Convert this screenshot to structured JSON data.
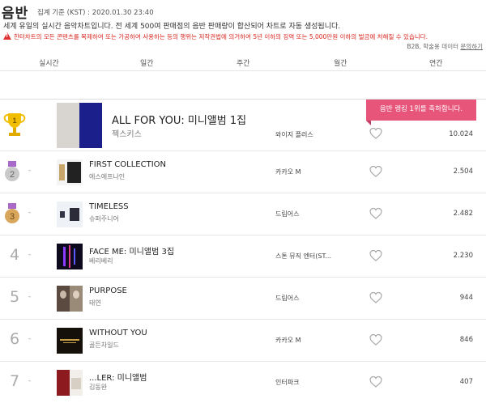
{
  "header": {
    "title": "음반",
    "basis": "집계 기준 (KST) : 2020.01.30 23:40"
  },
  "description": "세계 유일의 실시간 음악차트입니다. 전 세계 500여 판매점의 음반 판매량이 합산되어 차트로 자동 생성됩니다.",
  "warning": "한터차트의 모든 콘텐츠를 복제하여 또는 가공하여 사용하는 등의 행위는 저작권법에 의거하여 5년 이하의 징역 또는 5,000만원 이하의 벌금에 처해질 수 있습니다.",
  "b2b": {
    "text": "B2B, 학술용 데이터",
    "link": "문의하기"
  },
  "tabs": [
    "실시간",
    "일간",
    "주간",
    "월간",
    "연간"
  ],
  "ribbon": "음반 랭킹 1위를 축하합니다.",
  "rows": [
    {
      "rank": "1",
      "change": "",
      "title": "ALL FOR YOU: 미니앨범 1집",
      "artist": "젝스키스",
      "label": "와이지 플러스",
      "count": "10.024"
    },
    {
      "rank": "2",
      "change": "-",
      "title": "FIRST COLLECTION",
      "artist": "에스에프나인",
      "label": "카카오 M",
      "count": "2.504"
    },
    {
      "rank": "3",
      "change": "-",
      "title": "TIMELESS",
      "artist": "슈퍼주니어",
      "label": "드림어스",
      "count": "2.482"
    },
    {
      "rank": "4",
      "change": "-",
      "title": "FACE ME: 미니앨범 3집",
      "artist": "베리베리",
      "label": "스톤 뮤직 엔터(ST...",
      "count": "2.230"
    },
    {
      "rank": "5",
      "change": "-",
      "title": "PURPOSE",
      "artist": "태연",
      "label": "드림어스",
      "count": "944"
    },
    {
      "rank": "6",
      "change": "-",
      "title": "WITHOUT YOU",
      "artist": "골든차일드",
      "label": "카카오 M",
      "count": "846"
    },
    {
      "rank": "7",
      "change": "-",
      "title": "...LER: 미니앨범",
      "artist": "김동완",
      "label": "인터파크",
      "count": "407"
    }
  ],
  "colors": {
    "accent": "#e8557b",
    "gold": "#e6b300",
    "warning": "#d9251d"
  }
}
